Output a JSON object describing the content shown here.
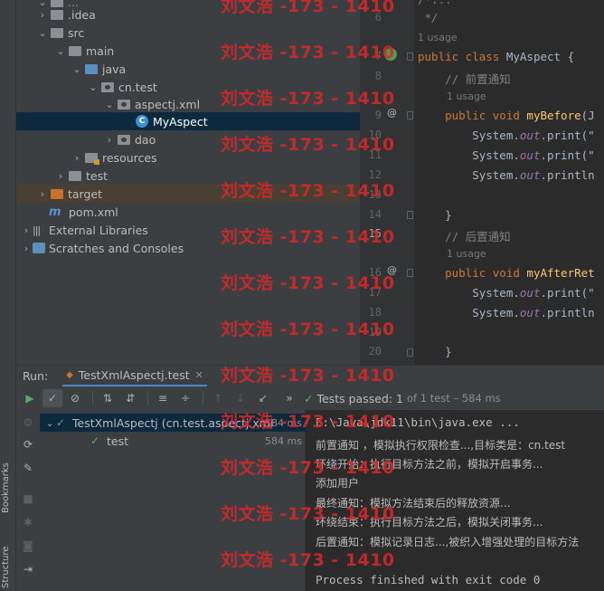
{
  "sidebar": {
    "bookmarks_label": "Bookmarks",
    "structure_label": "Structure"
  },
  "project_tree": {
    "top_partial": "...",
    "items": [
      {
        "label": ".idea",
        "depth": 1,
        "icon": "folder-icon",
        "arrow": "›"
      },
      {
        "label": "src",
        "depth": 1,
        "icon": "folder-icon",
        "arrow": "⌄"
      },
      {
        "label": "main",
        "depth": 2,
        "icon": "folder-icon",
        "arrow": "⌄"
      },
      {
        "label": "java",
        "depth": 3,
        "icon": "source-folder-icon",
        "arrow": "⌄"
      },
      {
        "label": "cn.test",
        "depth": 4,
        "icon": "package-icon",
        "arrow": "⌄"
      },
      {
        "label": "aspectj.xml",
        "depth": 5,
        "icon": "package-icon",
        "arrow": "⌄"
      },
      {
        "label": "MyAspect",
        "depth": 6,
        "icon": "class-icon",
        "arrow": ""
      },
      {
        "label": "dao",
        "depth": 5,
        "icon": "package-icon",
        "arrow": "›"
      },
      {
        "label": "resources",
        "depth": 4,
        "icon": "resources-folder-icon",
        "arrow": "›"
      },
      {
        "label": "test",
        "depth": 2,
        "icon": "folder-icon",
        "arrow": "›"
      },
      {
        "label": "target",
        "depth": 1,
        "icon": "excluded-folder-icon",
        "arrow": "›"
      },
      {
        "label": "pom.xml",
        "depth": 1,
        "icon": "maven-icon",
        "arrow": ""
      },
      {
        "label": "External Libraries",
        "depth": 0,
        "icon": "libraries-icon",
        "arrow": "›"
      },
      {
        "label": "Scratches and Consoles",
        "depth": 0,
        "icon": "scratches-icon",
        "arrow": "›"
      }
    ]
  },
  "editor": {
    "usage_hint": "1 usage",
    "line_numbers": [
      "6",
      "7",
      "8",
      "9",
      "10",
      "11",
      "12",
      "13",
      "14",
      "15",
      "16",
      "17",
      "18",
      "19",
      "20"
    ],
    "current_line": "15",
    "code": {
      "l5": "/*...",
      "l6": " */",
      "l7_kw": "public class ",
      "l7_name": "MyAspect",
      "l7_rest": " {",
      "l8": "    // 前置通知",
      "l9_kw": "    public void ",
      "l9_fn": "myBefore",
      "l9_rest": "(J",
      "l10_a": "        System.",
      "l10_out": "out",
      "l10_b": ".print(\"",
      "l11_a": "        System.",
      "l11_out": "out",
      "l11_b": ".print(\"",
      "l12_a": "        System.",
      "l12_out": "out",
      "l12_b": ".println",
      "l14": "    }",
      "l15": "    // 后置通知",
      "l16_kw": "    public void ",
      "l16_fn": "myAfterRet",
      "l17_a": "        System.",
      "l17_out": "out",
      "l17_b": ".print(\"",
      "l18_a": "        System.",
      "l18_out": "out",
      "l18_b": ".println",
      "l20": "    }"
    }
  },
  "run_window": {
    "title": "Run:",
    "tab_label": "TestXmlAspectj.test",
    "status_prefix": "Tests passed:",
    "status_count": "1",
    "status_suffix": "of 1 test – 584 ms",
    "tests": [
      {
        "label": "TestXmlAspectj (cn.test.aspectj.xml",
        "duration": "584 ms"
      },
      {
        "label": "test",
        "duration": "584 ms"
      }
    ],
    "console": {
      "cmd": "E:\\Java\\jdk11\\bin\\java.exe ...",
      "lines": [
        "前置通知 ，模拟执行权限检查...,目标类是：cn.test",
        "环绕开始：执行目标方法之前，模拟开启事务...",
        "添加用户",
        "最终通知：模拟方法结束后的释放资源...",
        "环绕结束：执行目标方法之后，模拟关闭事务...",
        "后置通知：模拟记录日志...,被织入增强处理的目标方法"
      ],
      "exit": "Process finished with exit code 0"
    }
  },
  "watermark": "刘文浩 -173 - 1410"
}
